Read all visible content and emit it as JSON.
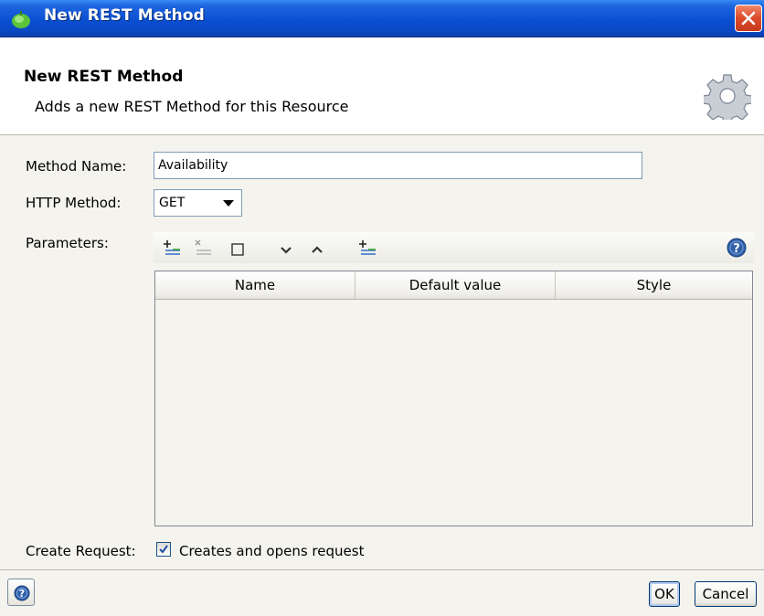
{
  "window": {
    "title": "New REST Method"
  },
  "header": {
    "title": "New REST Method",
    "subtitle": "Adds a new REST Method for this Resource"
  },
  "form": {
    "method_name_label": "Method Name:",
    "method_name_value": "Availability",
    "http_method_label": "HTTP Method:",
    "http_method_value": "GET",
    "parameters_label": "Parameters:",
    "create_request_label": "Create Request:",
    "create_request_checkbox_label": "Creates and opens request",
    "create_request_checked": true
  },
  "toolbar": {
    "icons": [
      "add-param-icon",
      "remove-param-icon",
      "clear-icon",
      "move-down-icon",
      "move-up-icon",
      "add-from-uri-icon",
      "help-icon"
    ]
  },
  "table": {
    "columns": [
      "Name",
      "Default value",
      "Style"
    ],
    "rows": []
  },
  "footer": {
    "ok_label": "OK",
    "cancel_label": "Cancel"
  },
  "colors": {
    "titlebar": "#0a4fd2",
    "accent_blue": "#2f5fa8",
    "close_red": "#dc4a2a"
  }
}
